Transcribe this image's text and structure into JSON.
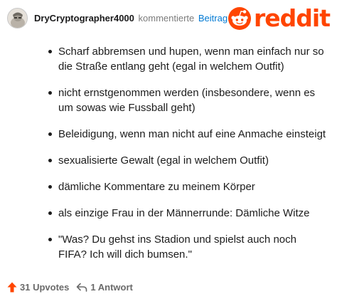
{
  "header": {
    "username": "DryCryptographer4000",
    "action_text": "kommentierte",
    "post_link": "Beitrag",
    "logo_text": "reddit"
  },
  "comment": {
    "items": [
      "Scharf abbremsen und hupen, wenn man einfach nur so die Straße entlang geht (egal in welchem Outfit)",
      "nicht ernstgenommen werden (insbesondere, wenn es um sowas wie Fussball geht)",
      "Beleidigung, wenn man nicht auf eine Anmache einsteigt",
      "sexualisierte Gewalt (egal in welchem Outfit)",
      "dämliche Kommentare zu meinem Körper",
      "als einzige Frau in der Männerrunde: Dämliche Witze",
      "\"Was? Du gehst ins Stadion und spielst auch noch FIFA? Ich will dich bumsen.\""
    ]
  },
  "footer": {
    "upvotes": "31 Upvotes",
    "replies": "1 Antwort"
  },
  "colors": {
    "brand": "#ff4500",
    "link": "#0079d3",
    "muted": "#7c7c7c"
  }
}
